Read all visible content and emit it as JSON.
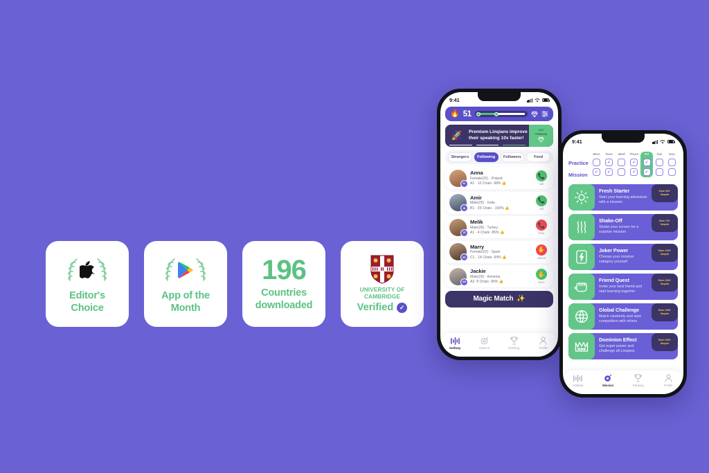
{
  "background_color": "#6A61D4",
  "accent_green": "#5BC283",
  "accent_purple": "#5A50C8",
  "badges": [
    {
      "type": "laurel-apple",
      "icon": "apple-icon",
      "label": "Editor's\nChoice",
      "line1": "Editor's",
      "line2": "Choice"
    },
    {
      "type": "laurel-play",
      "icon": "google-play-icon",
      "label": "App of the\nMonth",
      "line1": "App of the",
      "line2": "Month"
    },
    {
      "type": "number",
      "number": "196",
      "line1": "Countries",
      "line2": "downloaded"
    },
    {
      "type": "cambridge",
      "icon": "cambridge-crest-icon",
      "name_line1": "UNIVERSITY OF",
      "name_line2": "CAMBRIDGE",
      "verified_label": "Verified",
      "check": "✓"
    }
  ],
  "phone1": {
    "status": {
      "time": "9:41",
      "signal": "signal-icon",
      "wifi": "wifi-icon",
      "battery": "battery-icon"
    },
    "streak": {
      "flame_icon": "flame-icon",
      "count": "51",
      "progress_value": "14.33",
      "progress_percent": 38,
      "gem_icon": "gem-icon",
      "settings_icon": "sliders-icon"
    },
    "promo": {
      "rocket_icon": "rocket-icon",
      "line1": "Premium Linqians improve",
      "line2": "their speaking 10x faster!",
      "cta_line1": "GET",
      "cta_line2": "PREMIUM",
      "cta_gem_icon": "gem-icon"
    },
    "filters": [
      {
        "label": "Strangers",
        "active": false
      },
      {
        "label": "Following",
        "active": true
      },
      {
        "label": "Followers",
        "active": false
      },
      {
        "label": "Feed",
        "active": false
      }
    ],
    "users": [
      {
        "name": "Anna",
        "meta1": "Female(25) · Poland",
        "meta2": "A1 · 10 Chats ·98%",
        "thumb": "👍",
        "action_label": "call",
        "action_icon": "phone-icon",
        "action_color": "green",
        "flag": "Poland"
      },
      {
        "name": "Amir",
        "meta1": "Male(25) · India",
        "meta2": "B1 · 25 Chats · 100%",
        "thumb": "👍",
        "action_label": "call",
        "action_icon": "phone-icon",
        "action_color": "green",
        "flag": "India"
      },
      {
        "name": "Melik",
        "meta1": "Male(28) · Turkey",
        "meta2": "A1 · 4 Chats ·85%",
        "thumb": "👍",
        "action_label": "busy",
        "action_icon": "phone-icon",
        "action_color": "red",
        "flag": "Turkey"
      },
      {
        "name": "Marry",
        "meta1": "Female(22) · Spain",
        "meta2": "C1 · 14 Chats ·94%",
        "thumb": "👍",
        "action_label": "waved",
        "action_icon": "wave-icon",
        "action_color": "red",
        "flag": "Spain"
      },
      {
        "name": "Jackie",
        "meta1": "Male(29) · Armenia",
        "meta2": "A2· 8 Chats ·95%",
        "thumb": "👍",
        "action_label": "wave",
        "action_icon": "wave-icon",
        "action_color": "green",
        "flag": "Armenia"
      }
    ],
    "magic_match": {
      "label": "Magic Match",
      "sparkle_icon": "sparkles-icon"
    },
    "tabs": [
      {
        "label": "Hallway",
        "icon": "hallway-icon",
        "active": true
      },
      {
        "label": "Mission",
        "icon": "target-icon",
        "active": false
      },
      {
        "label": "Ranking",
        "icon": "trophy-icon",
        "active": false
      },
      {
        "label": "Profile",
        "icon": "person-icon",
        "active": false
      }
    ]
  },
  "phone2": {
    "status": {
      "time": "9:41",
      "signal": "signal-icon",
      "wifi": "wifi-icon",
      "battery": "battery-icon"
    },
    "calendar": {
      "row_labels": [
        "Practice",
        "Mission"
      ],
      "days": [
        "Mon",
        "Tues",
        "Wed",
        "Thurs",
        "Fri",
        "Sat",
        "Sun"
      ],
      "highlight_day": "Fri",
      "practice": [
        false,
        true,
        false,
        true,
        true,
        false,
        false
      ],
      "mission": [
        true,
        true,
        false,
        true,
        true,
        false,
        false
      ],
      "check_glyph": "✓"
    },
    "missions": [
      {
        "icon": "sun-icon",
        "title": "Fresh Starter",
        "desc1": "Start your learning adventure",
        "desc2": "with a mission",
        "badge1": "Earn 50+",
        "badge2": "linqoin"
      },
      {
        "icon": "waves-icon",
        "title": "Shake-Off",
        "desc1": "Shake your screen for a",
        "desc2": "surprise mission",
        "badge1": "Earn 75+",
        "badge2": "linqoin"
      },
      {
        "icon": "lightning-card-icon",
        "title": "Joker Power",
        "desc1": "Choose your mission",
        "desc2": "category yourself",
        "badge1": "Earn 100+",
        "badge2": "linqoin"
      },
      {
        "icon": "fist-icon",
        "title": "Friend Quest",
        "desc1": "Invite your best friend and",
        "desc2": "start learning together",
        "badge1": "Earn 300+",
        "badge2": "linqoin"
      },
      {
        "icon": "globe-icon",
        "title": "Global Challenge",
        "desc1": "Match randomly and start",
        "desc2": "competition with others",
        "badge1": "Earn 150+",
        "badge2": "linqoin"
      },
      {
        "icon": "crown-icon",
        "title": "Dominion Effect",
        "desc1": "Get super power and",
        "desc2": "challenge all Linqians",
        "badge1": "Earn 600+",
        "badge2": "linqoin"
      }
    ],
    "tabs": [
      {
        "label": "Hallway",
        "icon": "hallway-icon",
        "active": false
      },
      {
        "label": "Mission",
        "icon": "target-icon",
        "active": true
      },
      {
        "label": "Ranking",
        "icon": "trophy-icon",
        "active": false
      },
      {
        "label": "Profile",
        "icon": "person-icon",
        "active": false
      }
    ]
  }
}
